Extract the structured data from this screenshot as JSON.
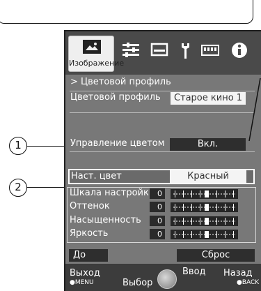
{
  "tabs": {
    "active_label": "Изображение",
    "icons": [
      "picture-tab",
      "input-output-tab",
      "display-tab",
      "setup-tab",
      "lan-tab",
      "info-tab"
    ]
  },
  "breadcrumb": "> Цветовой профиль",
  "color_profile": {
    "label": "Цветовой профиль",
    "value": "Старое кино 1"
  },
  "color_management": {
    "label": "Управление цветом",
    "value": "Вкл."
  },
  "base_color": {
    "label": "Наст. цвет",
    "value": "Красный"
  },
  "adjustments": [
    {
      "label": "Шкала настройки",
      "value": "0"
    },
    {
      "label": "Оттенок",
      "value": "0"
    },
    {
      "label": "Насыщенность",
      "value": "0"
    },
    {
      "label": "Яркость",
      "value": "0"
    }
  ],
  "buttons": {
    "before": "До",
    "reset": "Сброс"
  },
  "footer": {
    "exit": "Выход",
    "exit_key": "●MENU",
    "select": "Выбор",
    "enter": "Ввод",
    "back": "Назад",
    "back_key": "●BACK"
  },
  "callouts": {
    "one": "1",
    "two": "2"
  },
  "colors": {
    "panel": "#787878",
    "tabbar": "#4a4a4a",
    "value_dark": "#2e2e2e",
    "highlight": "#ffffff"
  }
}
